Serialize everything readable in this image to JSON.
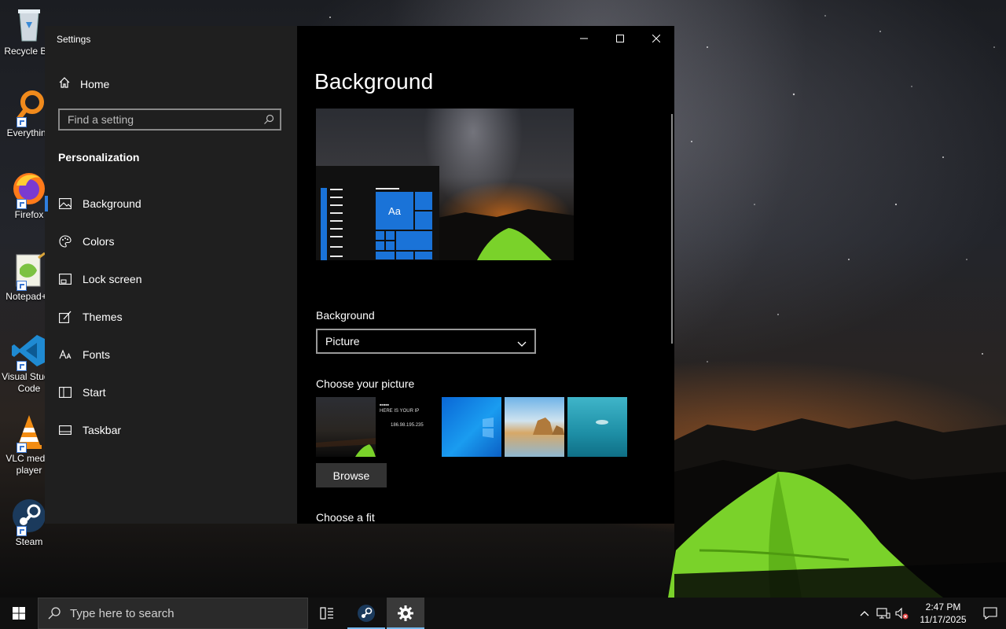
{
  "desktop": {
    "icons": [
      {
        "label": "Recycle Bin"
      },
      {
        "label": "Everything"
      },
      {
        "label": "Firefox"
      },
      {
        "label": "Notepad++"
      },
      {
        "label": "Visual Studio",
        "label2": "Code"
      },
      {
        "label": "VLC media",
        "label2": "player"
      },
      {
        "label": "Steam"
      }
    ]
  },
  "settings": {
    "app_title": "Settings",
    "home_label": "Home",
    "search_placeholder": "Find a setting",
    "section_title": "Personalization",
    "nav": [
      {
        "label": "Background",
        "icon": "picture-icon",
        "active": true
      },
      {
        "label": "Colors",
        "icon": "palette-icon"
      },
      {
        "label": "Lock screen",
        "icon": "lock-screen-icon"
      },
      {
        "label": "Themes",
        "icon": "themes-icon"
      },
      {
        "label": "Fonts",
        "icon": "fonts-icon"
      },
      {
        "label": "Start",
        "icon": "start-icon"
      },
      {
        "label": "Taskbar",
        "icon": "taskbar-icon"
      }
    ],
    "page_title": "Background",
    "preview_tile_text": "Aa",
    "background_label": "Background",
    "background_value": "Picture",
    "choose_picture_label": "Choose your picture",
    "thumb_text": {
      "line1": "HERE IS YOUR IP",
      "line2": "186.98.195.235"
    },
    "browse_label": "Browse",
    "choose_fit_label": "Choose a fit"
  },
  "taskbar": {
    "search_placeholder": "Type here to search",
    "time": "2:47 PM",
    "date": "11/17/2025"
  },
  "colors": {
    "accent": "#1a73d8",
    "taskbar_indicator": "#76b9ed",
    "settings_sidebar": "#1f1f1f",
    "settings_content": "#000000"
  }
}
